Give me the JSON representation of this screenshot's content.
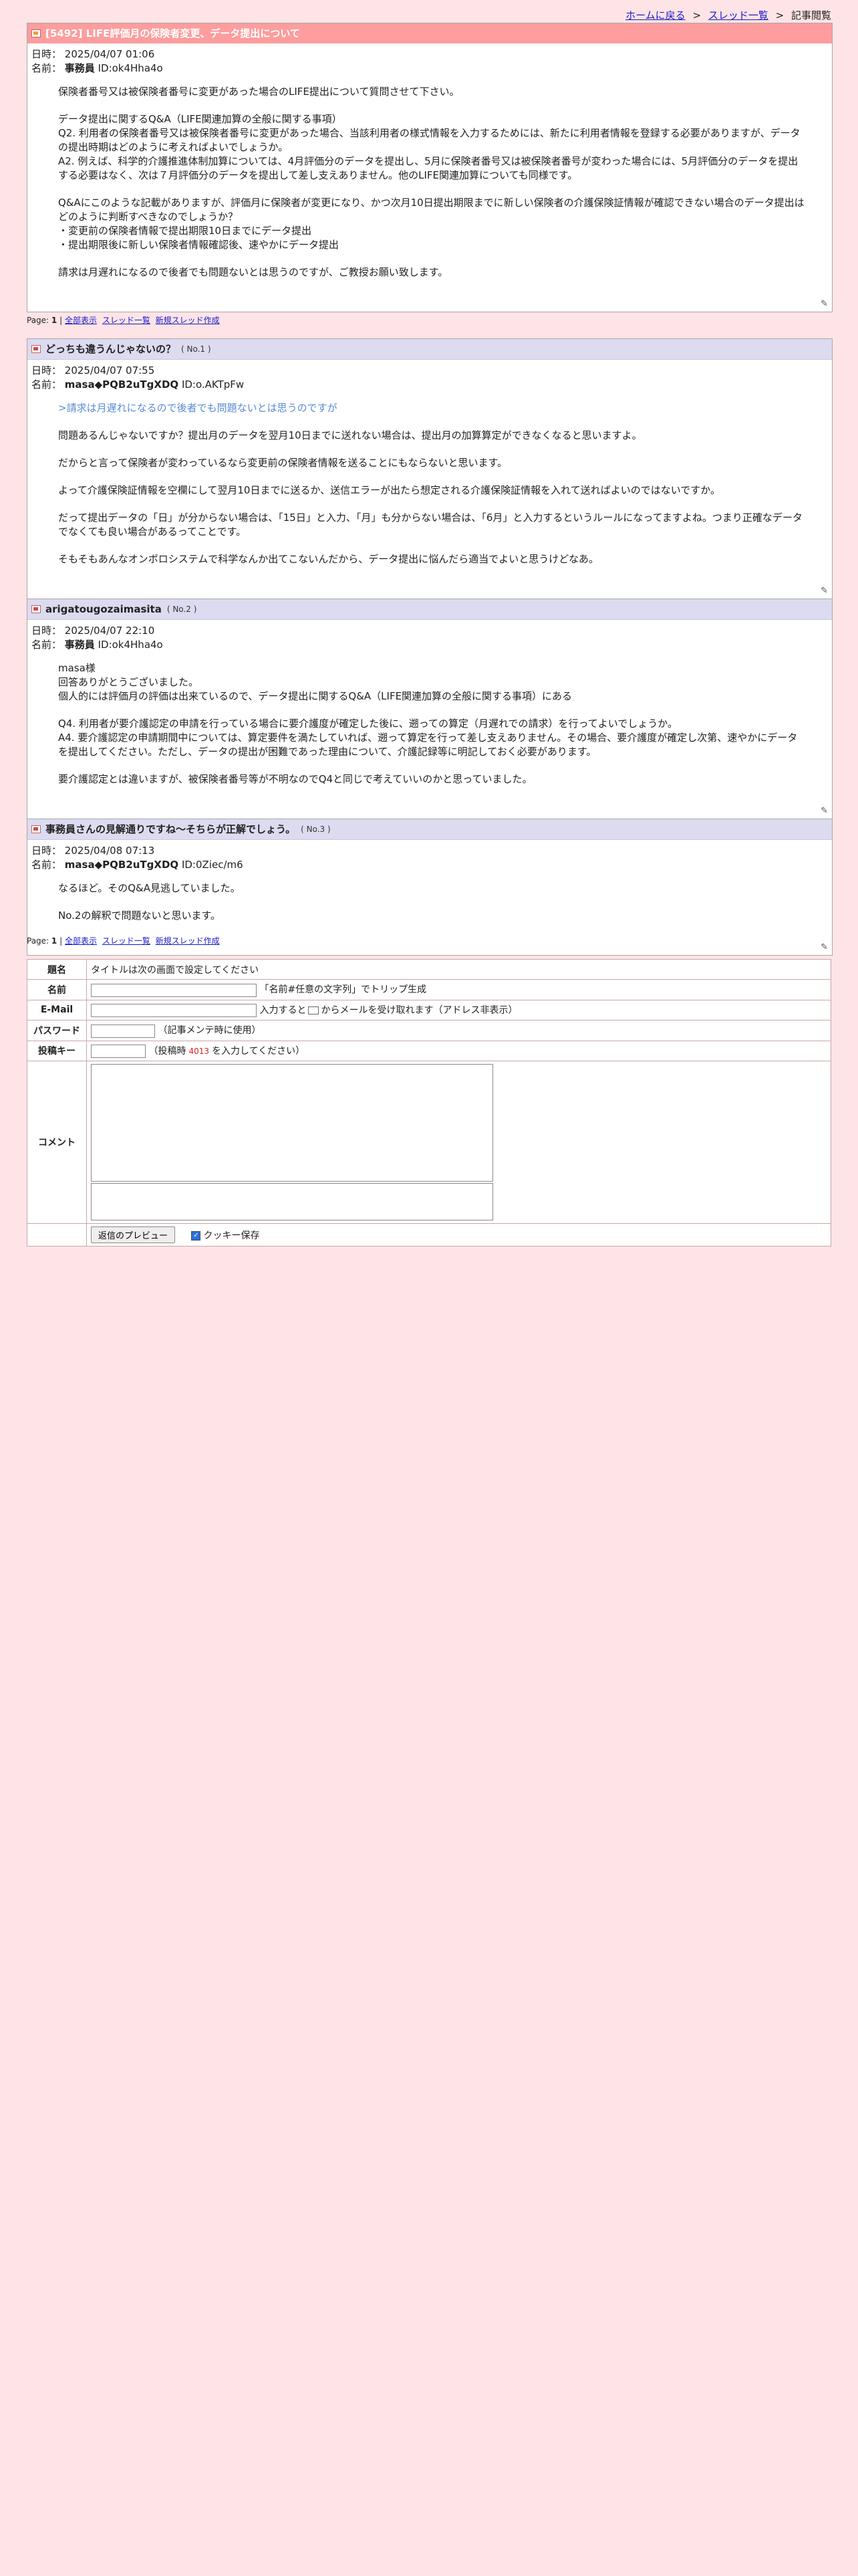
{
  "nav": {
    "home": "ホームに戻る",
    "sep1": ">",
    "thread_list": "スレッド一覧",
    "sep2": ">",
    "current": "記事閲覧"
  },
  "thread": {
    "title": "[5492] LIFE評価月の保険者変更、データ提出について",
    "date_label": "日時：",
    "date": "2025/04/07 01:06",
    "name_label": "名前：",
    "author": "事務員",
    "id": "ID:ok4Hha4o",
    "paragraphs": [
      "保険者番号又は被保険者番号に変更があった場合のLIFE提出について質問させて下さい。",
      "データ提出に関するQ&A（LIFE関連加算の全般に関する事項）\nQ2. 利用者の保険者番号又は被保険者番号に変更があった場合、当該利用者の様式情報を入力するためには、新たに利用者情報を登録する必要がありますが、データの提出時期はどのように考えればよいでしょうか。\nA2. 例えば、科学的介護推進体制加算については、4月評価分のデータを提出し、5月に保険者番号又は被保険者番号が変わった場合には、5月評価分のデータを提出する必要はなく、次は７月評価分のデータを提出して差し支えありません。他のLIFE関連加算についても同様です。",
      "Q&Aにこのような記載がありますが、評価月に保険者が変更になり、かつ次月10日提出期限までに新しい保険者の介護保険証情報が確認できない場合のデータ提出はどのように判断すべきなのでしょうか？\n・変更前の保険者情報で提出期限10日までにデータ提出\n・提出期限後に新しい保険者情報確認後、速やかにデータ提出",
      "請求は月遅れになるので後者でも問題ないとは思うのですが、ご教授お願い致します。"
    ]
  },
  "pager": {
    "label": "Page:",
    "current": "1",
    "bar": "|",
    "all": "全部表示",
    "list": "スレッド一覧",
    "new": "新規スレッド作成"
  },
  "posts": [
    {
      "title": "どっちも違うんじゃないの？",
      "num": "( No.1 )",
      "date": "2025/04/07 07:55",
      "author": "masa◆PQB2uTgXDQ",
      "id": "ID:o.AKTpFw",
      "quote": ">請求は月遅れになるので後者でも問題ないとは思うのですが",
      "paragraphs": [
        "問題あるんじゃないですか？提出月のデータを翌月10日までに送れない場合は、提出月の加算算定ができなくなると思いますよ。",
        "だからと言って保険者が変わっているなら変更前の保険者情報を送ることにもならないと思います。",
        "よって介護保険証情報を空欄にして翌月10日までに送るか、送信エラーが出たら想定される介護保険証情報を入れて送ればよいのではないですか。",
        "だって提出データの「日」が分からない場合は、「15日」と入力、「月」も分からない場合は、「6月」と入力するというルールになってますよね。つまり正確なデータでなくても良い場合があるってことです。",
        "そもそもあんなオンボロシステムで科学なんか出てこないんだから、データ提出に悩んだら適当でよいと思うけどなあ。"
      ]
    },
    {
      "title": "arigatougozaimasita",
      "num": "( No.2 )",
      "date": "2025/04/07 22:10",
      "author": "事務員",
      "id": "ID:ok4Hha4o",
      "quote": "",
      "paragraphs": [
        "masa様\n回答ありがとうございました。\n個人的には評価月の評価は出来ているので、データ提出に関するQ&A（LIFE関連加算の全般に関する事項）にある",
        "Q4. 利用者が要介護認定の申請を行っている場合に要介護度が確定した後に、遡っての算定（月遅れでの請求）を行ってよいでしょうか。\nA4. 要介護認定の申請期間中については、算定要件を満たしていれば、遡って算定を行って差し支えありません。その場合、要介護度が確定し次第、速やかにデータを提出してください。ただし、データの提出が困難であった理由について、介護記録等に明記しておく必要があります。",
        "要介護認定とは違いますが、被保険者番号等が不明なのでQ4と同じで考えていいのかと思っていました。"
      ]
    },
    {
      "title": "事務員さんの見解通りですね〜そちらが正解でしょう。",
      "num": "( No.3 )",
      "date": "2025/04/08 07:13",
      "author": "masa◆PQB2uTgXDQ",
      "id": "ID:0Ziec/m6",
      "quote": "",
      "paragraphs": [
        "なるほど。そのQ&A見逃していました。",
        "No.2の解釈で問題ないと思います。"
      ]
    }
  ],
  "form": {
    "subject_label": "題名",
    "subject_value": "タイトルは次の画面で設定してください",
    "name_label": "名前",
    "name_hint": "「名前#任意の文字列」でトリップ生成",
    "email_label": "E-Mail",
    "email_hint_pre": "入力すると",
    "email_hint_post": "からメールを受け取れます（アドレス非表示）",
    "password_label": "パスワード",
    "password_hint": "（記事メンテ時に使用）",
    "key_label": "投稿キー",
    "key_hint_pre": "（投稿時",
    "key_value": "4013",
    "key_hint_post": "を入力してください）",
    "comment_label": "コメント",
    "preview_button": "返信のプレビュー",
    "cookie_label": "クッキー保存"
  },
  "colors": {
    "background": "#fee4e6",
    "thread_header": "#fd9d9e",
    "post_header": "#dcdbf0",
    "quote": "#5a8ad6"
  }
}
